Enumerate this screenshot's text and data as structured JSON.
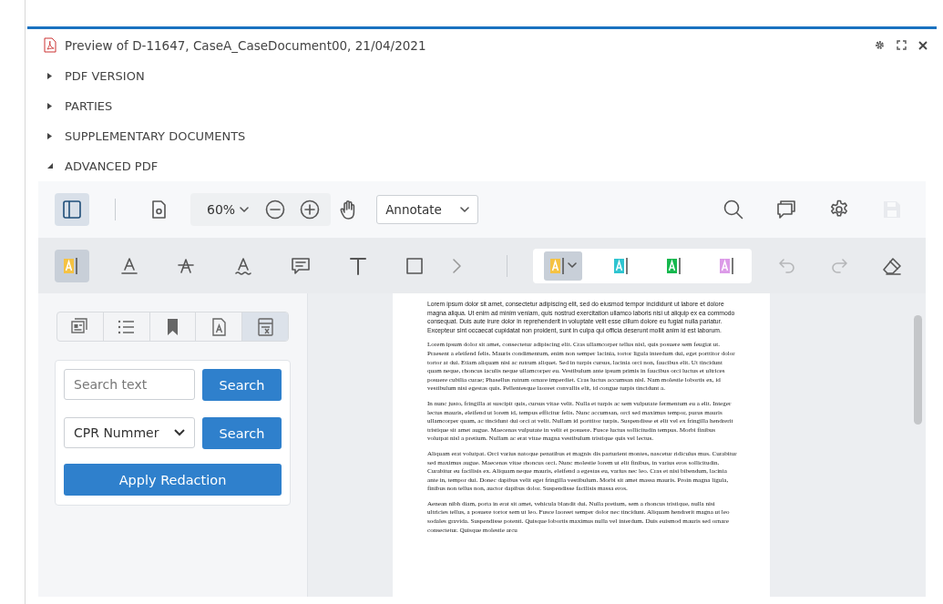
{
  "window": {
    "title": "Preview of D-11647, CaseA_CaseDocument00, 21/04/2021"
  },
  "sections": [
    {
      "label": "PDF VERSION",
      "expanded": false
    },
    {
      "label": "PARTIES",
      "expanded": false
    },
    {
      "label": "SUPPLEMENTARY DOCUMENTS",
      "expanded": false
    },
    {
      "label": "ADVANCED PDF",
      "expanded": true
    }
  ],
  "viewer": {
    "sidebar_open": true,
    "zoom": "60%",
    "mode": "Annotate",
    "actions": [
      {
        "kind": "search",
        "disabled": false
      },
      {
        "kind": "comments",
        "disabled": false
      },
      {
        "kind": "settings",
        "disabled": false
      },
      {
        "kind": "save",
        "disabled": true
      }
    ],
    "annotation_tools": [
      {
        "kind": "highlight",
        "selected": true
      },
      {
        "kind": "underline",
        "selected": false
      },
      {
        "kind": "strikeout",
        "selected": false
      },
      {
        "kind": "squiggly",
        "selected": false
      },
      {
        "kind": "comment",
        "selected": false
      },
      {
        "kind": "text",
        "selected": false
      },
      {
        "kind": "shape",
        "selected": false
      },
      {
        "kind": "more",
        "selected": false
      }
    ],
    "highlight_colors": [
      {
        "color": "#f5c242",
        "selected": true
      },
      {
        "color": "#2ec4d0",
        "selected": false
      },
      {
        "color": "#16b84e",
        "selected": false
      },
      {
        "color": "#dc9be8",
        "selected": false
      }
    ],
    "edit_actions": [
      {
        "kind": "undo",
        "disabled": true
      },
      {
        "kind": "redo",
        "disabled": true
      },
      {
        "kind": "eraser",
        "disabled": false
      }
    ],
    "side_tabs": [
      {
        "kind": "thumbnails",
        "selected": false
      },
      {
        "kind": "outline",
        "selected": false
      },
      {
        "kind": "bookmarks",
        "selected": false
      },
      {
        "kind": "layers",
        "selected": false
      },
      {
        "kind": "redaction",
        "selected": true
      }
    ],
    "redaction": {
      "search_placeholder": "Search text",
      "search_button": "Search",
      "pattern": "CPR Nummer",
      "pattern_button": "Search",
      "apply_button": "Apply Redaction"
    },
    "page": {
      "paragraphs": [
        {
          "kind": "sans",
          "text": "Lorem ipsum dolor sit amet, consectetur adipiscing elit, sed do eiusmod tempor incididunt ut labore et dolore magna aliqua. Ut enim ad minim veniam, quis nostrud exercitation ullamco laboris nisi ut aliquip ex ea commodo consequat. Duis aute irure dolor in reprehenderit in voluptate velit esse cillum dolore eu fugiat nulla pariatur. Excepteur sint occaecat cupidatat non proident, sunt in culpa qui officia deserunt mollit anim id est laborum."
        },
        {
          "kind": "serif",
          "text": "Lorem ipsum dolor sit amet, consectetur adipiscing elit. Cras ullamcorper tellus nisl, quis posuere sem feugiat ut. Praesent a eleifend felis. Mauris condimentum, enim non semper lacinia, tortor ligula interdum dui, eget porttitor dolor tortor at dui. Etiam aliquam nisi ac rutrum aliquet. Sed in turpis cursus, lacinia orci non, faucibus elit. Ut tincidunt quam neque, rhoncus iaculis neque ullamcorper eu. Vestibulum ante ipsum primis in faucibus orci luctus et ultrices posuere cubilia curae; Phasellus rutrum ornare imperdiet. Cras luctus accumsan nisl. Nam molestie lobortis ex, id vestibulum nisi egestas quis. Pellentesque laoreet convallis elit, id congue turpis tincidunt a."
        },
        {
          "kind": "serif",
          "text": "In nunc justo, fringilla at suscipit quis, cursus vitae velit. Nulla et turpis ac sem vulputate fermentum eu a elit. Integer lectus mauris, eleifend ut lorem id, tempus efficitur felis. Nunc accumsan, orci sed maximus tempor, purus mauris ullamcorper quam, ac tincidunt dui orci at velit. Nullam id porttitor turpis. Suspendisse et elit vel ex fringilla hendrerit tristique sit amet augue. Maecenas vulputate in velit et posuere. Fusce luctus sollicitudin tempus. Morbi finibus volutpat nisl a pretium. Nullam ac erat vitae magna vestibulum tristique quis vel lectus."
        },
        {
          "kind": "serif",
          "text": "Aliquam erat volutpat. Orci varius natoque penatibus et magnis dis parturient montes, nascetur ridiculus mus. Curabitur sed maximus augue. Maecenas vitae rhoncus orci. Nunc molestie lorem ut elit finibus, in varius eros sollicitudin. Curabitur eu facilisis ex. Aliquam neque mauris, eleifend a egestas eu, varius nec leo. Cras et nisi bibendum, lacinia ante in, tempor dui. Donec dapibus velit eget fringilla vestibulum. Morbi sit amet massa mauris. Proin magna ligula, finibus non tellus non, auctor dapibus dolor. Suspendisse facilisis massa eros."
        },
        {
          "kind": "serif",
          "text": "Aenean nibh diam, porta in erat sit amet, vehicula blandit dui. Nulla pretium, sem a rhoncus tristique, nulla nisi ultricies tellus, a posuere tortor sem ut leo. Fusce laoreet semper dolor nec tincidunt. Aliquam hendrerit magna ut leo sodales gravida. Suspendisse potenti. Quisque lobortis maximus nulla vel interdum. Duis euismod mauris sed ornare consectetur. Quisque molestie arcu"
        }
      ]
    }
  }
}
